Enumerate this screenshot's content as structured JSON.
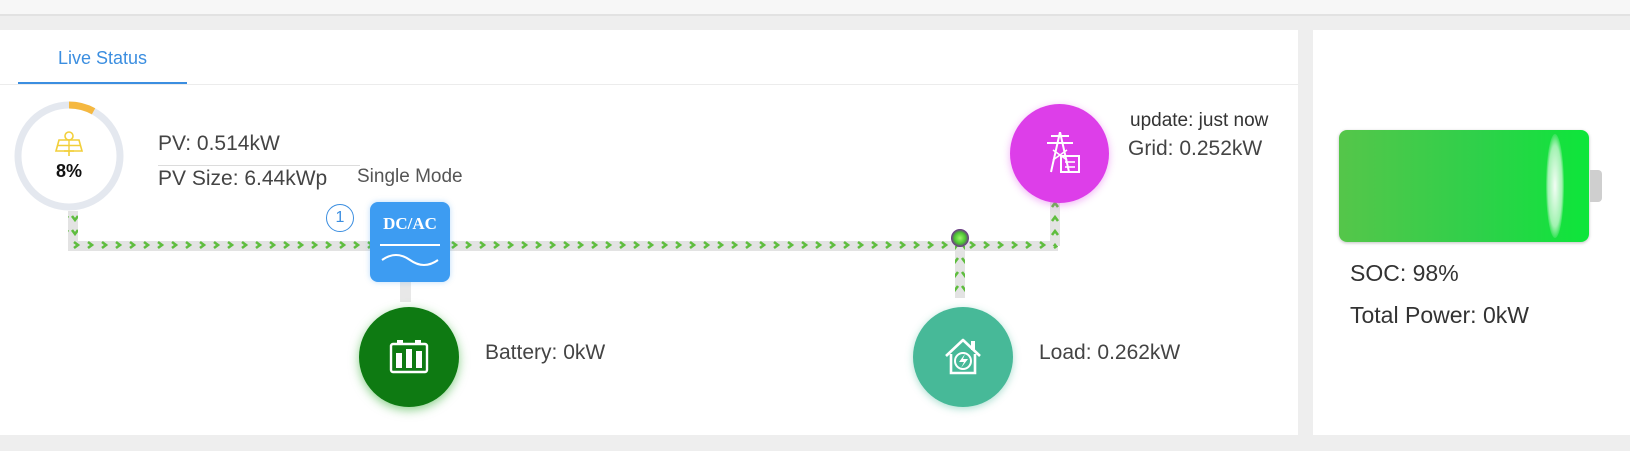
{
  "tabs": [
    {
      "label": "Live Status"
    }
  ],
  "pv": {
    "label": "PV: 0.514kW",
    "size_label": "PV Size: 6.44kWp",
    "percent_text": "8%",
    "percent": 8,
    "icon": "solar-panel-icon"
  },
  "inverter": {
    "mode": "Single Mode",
    "label": "DC/AC",
    "index": "1",
    "icon": "inverter-icon"
  },
  "grid": {
    "update_label": "update: just now",
    "label": "Grid: 0.252kW",
    "icon": "power-tower-icon"
  },
  "battery": {
    "label": "Battery: 0kW",
    "icon": "battery-icon"
  },
  "load": {
    "label": "Load: 0.262kW",
    "icon": "home-power-icon"
  },
  "summary": {
    "soc_label": "SOC: 98%",
    "soc": 98,
    "total_power_label": "Total Power: 0kW"
  },
  "colors": {
    "accent": "#3b8ee0",
    "flow": "#6cc04a",
    "pv_ring": "#f5b840",
    "grid": "#dd3ee9",
    "battery": "#0e7a12",
    "load": "#47b998",
    "inverter": "#3d9cf2"
  }
}
